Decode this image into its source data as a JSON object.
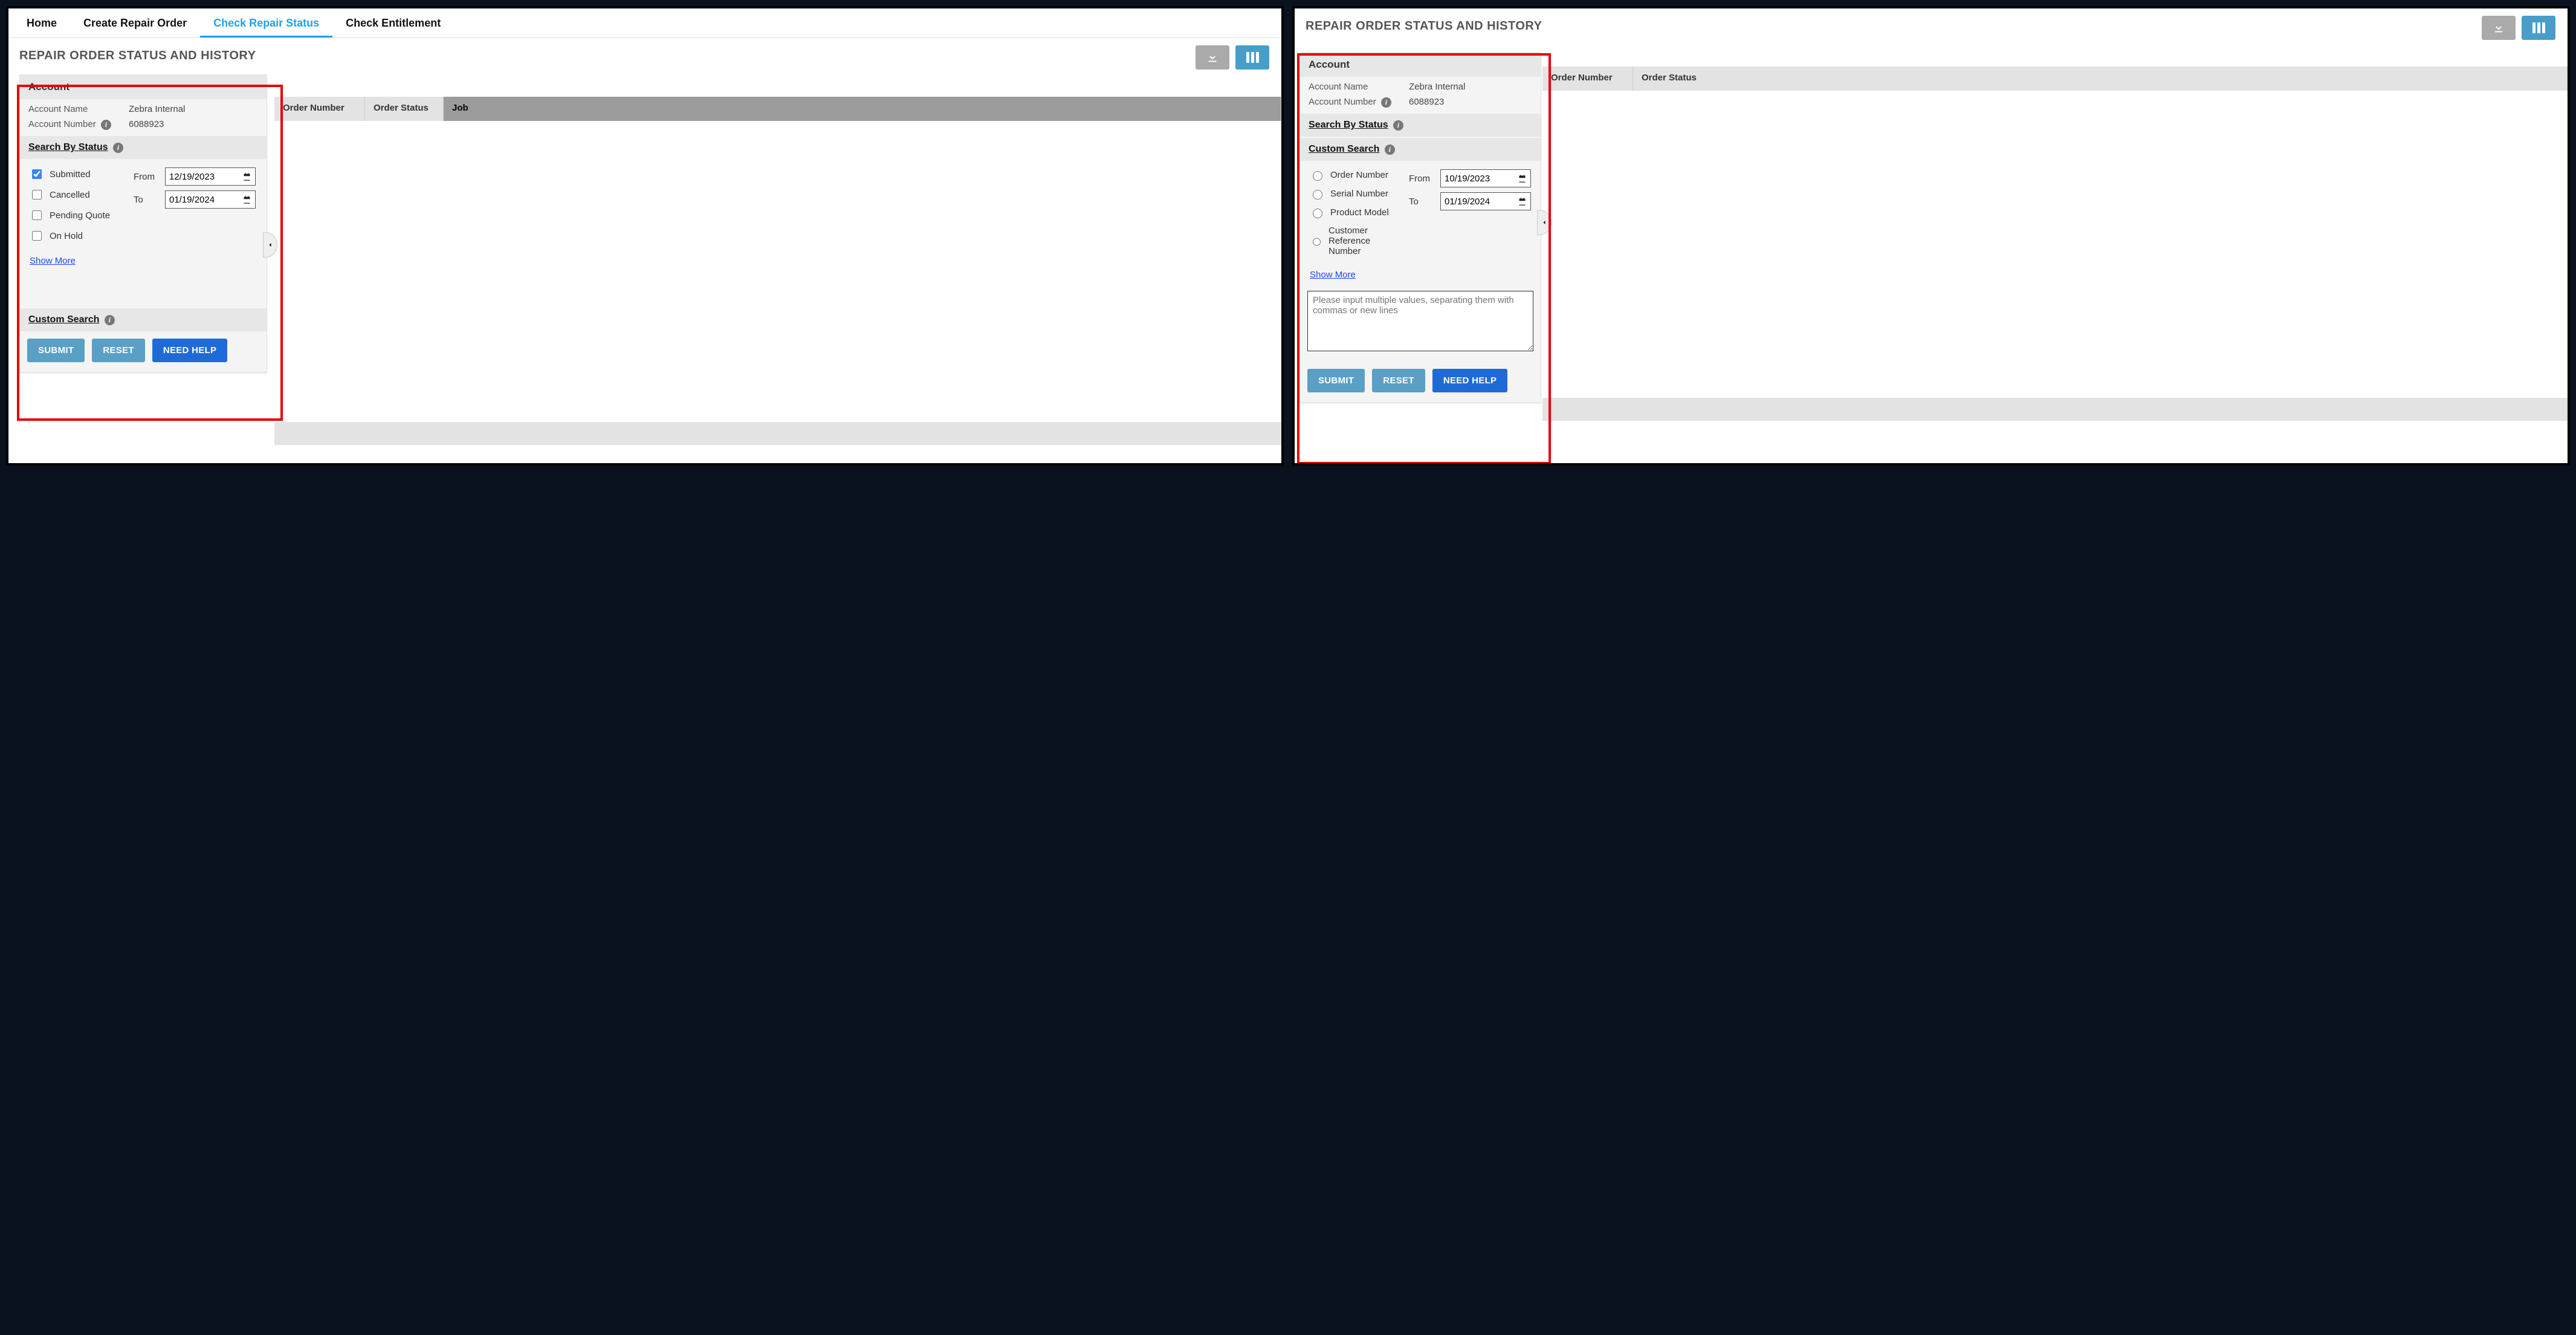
{
  "nav": {
    "home": "Home",
    "create": "Create Repair Order",
    "check_status": "Check Repair Status",
    "check_entitlement": "Check Entitlement"
  },
  "page_title": "REPAIR ORDER STATUS AND HISTORY",
  "account": {
    "header": "Account",
    "name_label": "Account Name",
    "name_value": "Zebra Internal",
    "number_label": "Account Number",
    "number_value": "6088923"
  },
  "search_status": {
    "header": "Search By Status",
    "options": [
      "Submitted",
      "Cancelled",
      "Pending Quote",
      "On Hold"
    ],
    "from_label": "From",
    "to_label": "To",
    "from_value": "12/19/2023",
    "to_value": "01/19/2024",
    "show_more": "Show More"
  },
  "custom_search": {
    "header": "Custom Search",
    "options": [
      "Order Number",
      "Serial Number",
      "Product Model",
      "Customer Reference Number"
    ],
    "from_value": "10/19/2023",
    "to_value": "01/19/2024",
    "placeholder": "Please input multiple values, separating them with commas or new lines"
  },
  "buttons": {
    "submit": "SUBMIT",
    "reset": "RESET",
    "help": "NEED HELP"
  },
  "table": {
    "order_number": "Order Number",
    "order_status": "Order Status",
    "job": "Job"
  }
}
